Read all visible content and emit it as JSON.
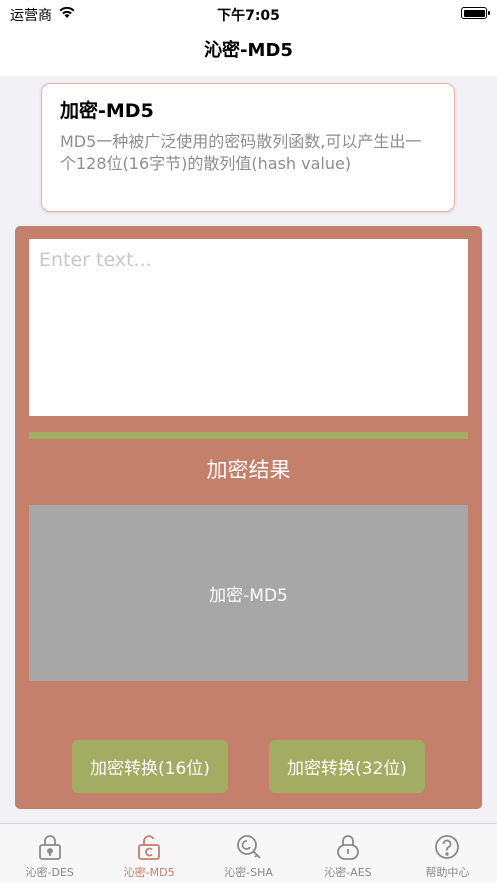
{
  "status_bar": {
    "carrier": "运营商",
    "time": "下午7:05"
  },
  "nav": {
    "title": "沁密-MD5"
  },
  "info_card": {
    "title": "加密-MD5",
    "description": "MD5一种被广泛使用的密码散列函数,可以产生出一个128位(16字节)的散列值(hash value)"
  },
  "input": {
    "placeholder": "Enter text...",
    "value": ""
  },
  "result": {
    "label": "加密结果",
    "value": "加密-MD5"
  },
  "buttons": {
    "convert16": "加密转换(16位)",
    "convert32": "加密转换(32位)"
  },
  "tabs": [
    {
      "label": "沁密-DES",
      "icon": "lock-icon"
    },
    {
      "label": "沁密-MD5",
      "icon": "unlock-icon"
    },
    {
      "label": "沁密-SHA",
      "icon": "key-icon"
    },
    {
      "label": "沁密-AES",
      "icon": "lock-icon"
    },
    {
      "label": "帮助中心",
      "icon": "help-icon"
    }
  ],
  "colors": {
    "accent": "#c5806c",
    "button": "#a2ac63",
    "result_bg": "#a7a7a7"
  }
}
